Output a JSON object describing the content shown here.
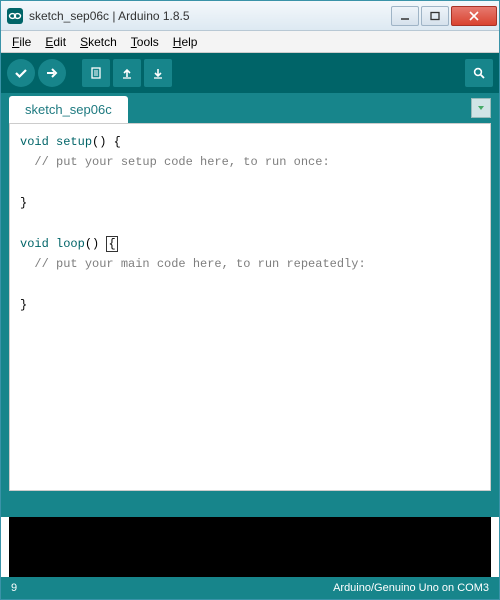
{
  "titlebar": {
    "text": "sketch_sep06c | Arduino 1.8.5"
  },
  "menu": {
    "items": [
      "File",
      "Edit",
      "Sketch",
      "Tools",
      "Help"
    ]
  },
  "tab": {
    "name": "sketch_sep06c"
  },
  "code": {
    "setup_sig_kw": "void",
    "setup_sig_fn": "setup",
    "setup_sig_rest": "() {",
    "setup_comment": "// put your setup code here, to run once:",
    "close_brace": "}",
    "loop_sig_kw": "void",
    "loop_sig_fn": "loop",
    "loop_sig_rest_a": "() ",
    "loop_brace": "{",
    "loop_comment": "// put your main code here, to run repeatedly:"
  },
  "status": {
    "line": "9",
    "board": "Arduino/Genuino Uno on COM3"
  }
}
